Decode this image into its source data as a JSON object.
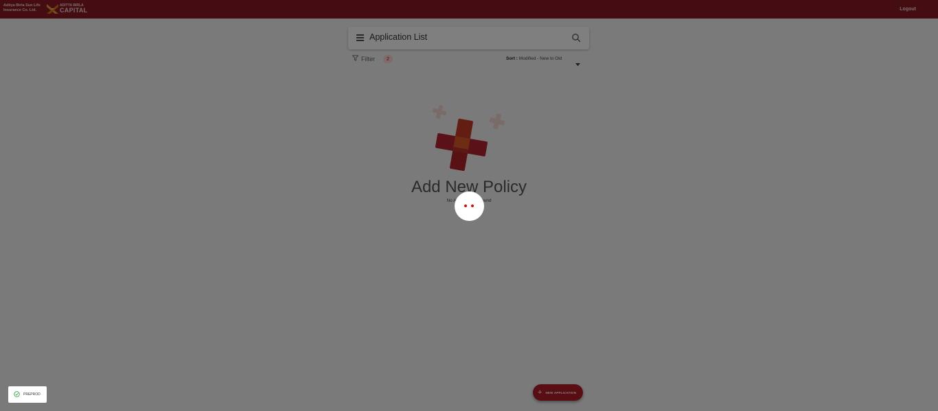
{
  "header": {
    "brand_left": "Aditya Birla Sun Life Insurance Co. Ltd.",
    "brand_right_small": "ADITYA BIRLA",
    "brand_right_big": "CAPITAL",
    "logout_label": "Logout",
    "bg_color": "#8b1a24"
  },
  "search": {
    "title": "Application List",
    "icon": "search-icon",
    "menu_icon": "hamburger-icon"
  },
  "toolbar": {
    "filter_label": "Filter",
    "filter_badge": "2",
    "sort_prefix": "Sort :",
    "sort_value": "Modified - New to Old"
  },
  "empty_state": {
    "title": "Add New Policy",
    "subtitle": "No Applications Found"
  },
  "fab": {
    "label": "NEW APPLICATION",
    "color": "#b01c24"
  },
  "environment": {
    "label": "PREPROD",
    "icon": "check-circle-icon"
  },
  "overlay": {
    "loading": true
  }
}
